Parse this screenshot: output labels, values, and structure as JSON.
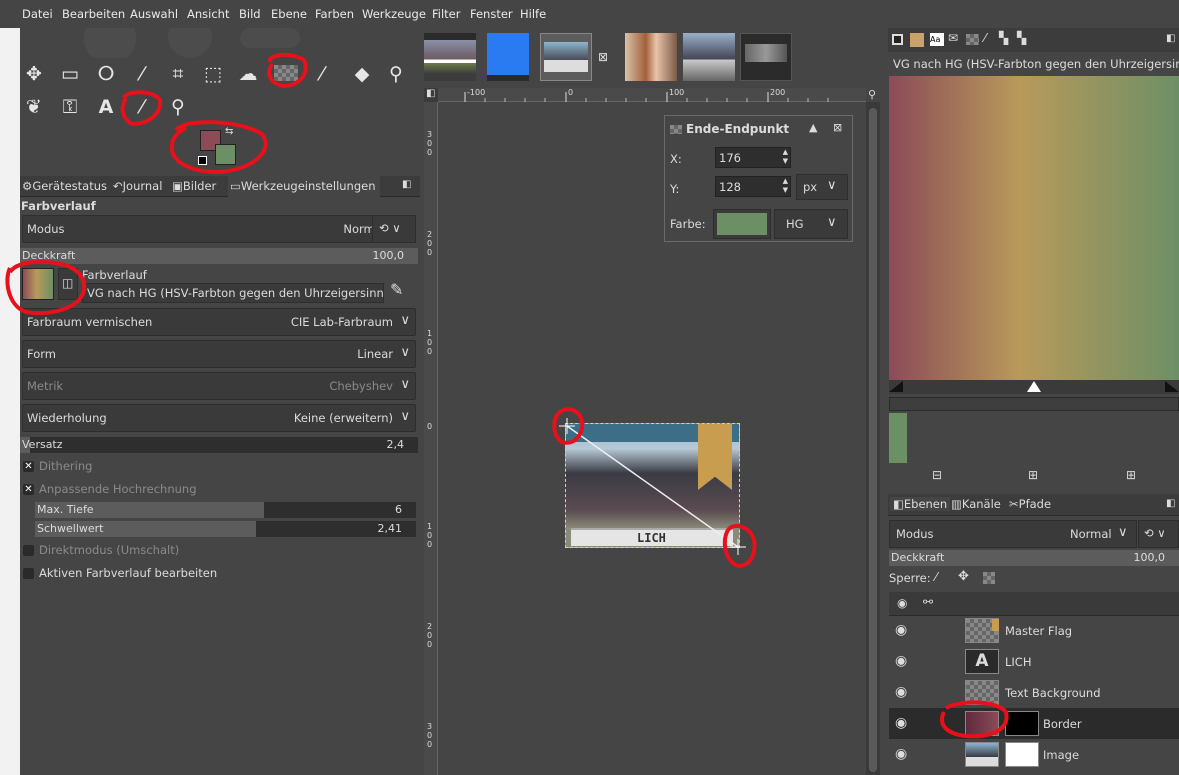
{
  "menu": [
    "Datei",
    "Bearbeiten",
    "Auswahl",
    "Ansicht",
    "Bild",
    "Ebene",
    "Farben",
    "Werkzeuge",
    "Filter",
    "Fenster",
    "Hilfe"
  ],
  "tabs_left": {
    "status": "Gerätestatus",
    "journal": "Journal",
    "images": "Bilder",
    "tool_options": "Werkzeugeinstellungen"
  },
  "tool_options": {
    "title": "Farbverlauf",
    "mode_label": "Modus",
    "mode_value": "Normal",
    "opacity_label": "Deckkraft",
    "opacity_value": "100,0",
    "gradient_label": "Farbverlauf",
    "gradient_name": "VG nach HG (HSV-Farbton gegen den Uhrzeigersinn)",
    "blend_space_label": "Farbraum vermischen",
    "blend_space_value": "CIE Lab-Farbraum",
    "shape_label": "Form",
    "shape_value": "Linear",
    "metric_label": "Metrik",
    "metric_value": "Chebyshev",
    "repeat_label": "Wiederholung",
    "repeat_value": "Keine (erweitern)",
    "offset_label": "Versatz",
    "offset_value": "2,4",
    "dithering": "Dithering",
    "adaptive": "Anpassende Hochrechnung",
    "max_depth_label": "Max. Tiefe",
    "max_depth_value": "6",
    "threshold_label": "Schwellwert",
    "threshold_value": "2,41",
    "instant": "Direktmodus (Umschalt)",
    "edit_active": "Aktiven Farbverlauf bearbeiten"
  },
  "ruler": {
    "h": [
      "-100",
      "0",
      "100",
      "200"
    ],
    "v": [
      "300",
      "200",
      "100",
      "0",
      "100",
      "200",
      "300"
    ]
  },
  "endpoint_dialog": {
    "title": "Ende-Endpunkt",
    "x_label": "X:",
    "x_value": "176",
    "y_label": "Y:",
    "y_value": "128",
    "unit": "px",
    "color_label": "Farbe:",
    "color_source": "HG"
  },
  "canvas_banner": "LICH",
  "gradient_panel": {
    "title": "VG nach HG (HSV-Farbton gegen den Uhrzeigersin"
  },
  "tabs_right": {
    "layers": "Ebenen",
    "channels": "Kanäle",
    "paths": "Pfade"
  },
  "layers_panel": {
    "mode_label": "Modus",
    "mode_value": "Normal",
    "opacity_label": "Deckkraft",
    "opacity_value": "100,0",
    "lock_label": "Sperre:",
    "layers": [
      {
        "name": "Master Flag"
      },
      {
        "name": "LICH"
      },
      {
        "name": "Text Background"
      },
      {
        "name": "Border"
      },
      {
        "name": "Image"
      }
    ]
  },
  "colors": {
    "foreground": "#8c4b57",
    "background": "#6d8f66",
    "accent_annotation": "#e8101a"
  }
}
